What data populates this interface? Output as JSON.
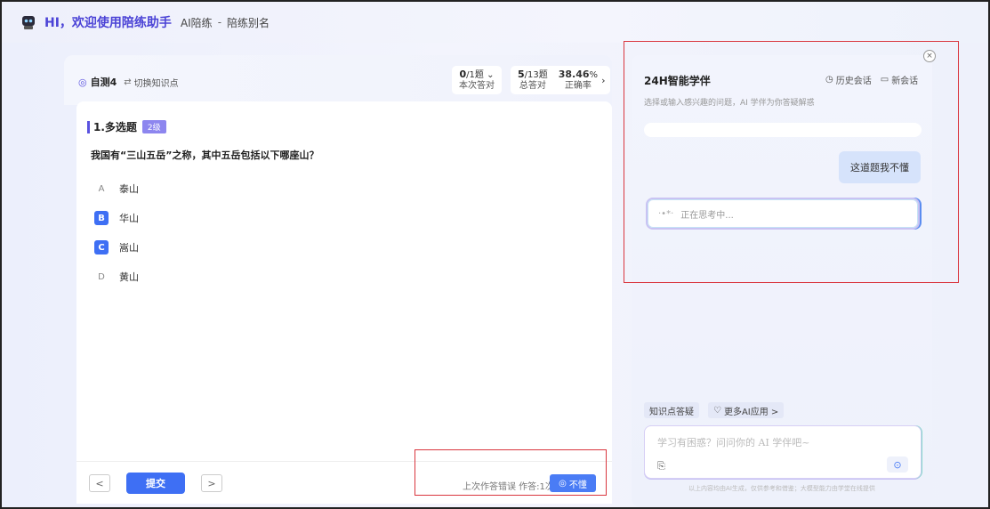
{
  "header": {
    "title": "HI，欢迎使用陪练助手",
    "crumb_1": "AI陪练",
    "crumb_sep": "-",
    "crumb_2": "陪练别名"
  },
  "left": {
    "self_test": "自测4",
    "switch_label": "切换知识点",
    "stats": {
      "current_value": "0",
      "current_total": "/1题",
      "current_label": "本次答对",
      "total_value": "5",
      "total_total": "/13题",
      "total_label": "总答对",
      "rate_value": "38.46",
      "rate_unit": "%",
      "rate_label": "正确率"
    },
    "question": {
      "type_label": "1.多选题",
      "level": "2级",
      "text": "我国有“三山五岳”之称，其中五岳包括以下哪座山？",
      "options": [
        {
          "letter": "A",
          "text": "泰山",
          "selected": false
        },
        {
          "letter": "B",
          "text": "华山",
          "selected": true
        },
        {
          "letter": "C",
          "text": "嵩山",
          "selected": true
        },
        {
          "letter": "D",
          "text": "黄山",
          "selected": false
        }
      ]
    },
    "bottom": {
      "prev": "<",
      "next": ">",
      "submit": "提交",
      "last_info": "上次作答错误  作答:1次",
      "dont_know": "不懂"
    }
  },
  "right": {
    "title": "24H智能学伴",
    "history": "历史会话",
    "new_chat": "新会话",
    "subtitle": "选择或输入感兴趣的问题，AI 学伴为你答疑解惑",
    "user_message": "这道题我不懂",
    "thinking": "正在思考中...",
    "chip_1": "知识点答疑",
    "chip_2": "更多AI应用 >",
    "placeholder": "学习有困惑？问问你的 AI 学伴吧~",
    "disclaimer": "以上内容均由AI生成，仅供参考和借鉴；大模型能力由学堂在线提供",
    "close": "×"
  },
  "colors": {
    "accent": "#4b43d6",
    "primary_blue": "#3e6ff4",
    "highlight_red": "#d9363e"
  },
  "icons": {
    "robot": "robot-icon",
    "target": "target-icon",
    "swap": "swap-icon",
    "clock": "clock-icon",
    "chat": "chat-icon",
    "bulb": "bulb-icon",
    "attach": "attach-icon",
    "send": "send-icon"
  }
}
